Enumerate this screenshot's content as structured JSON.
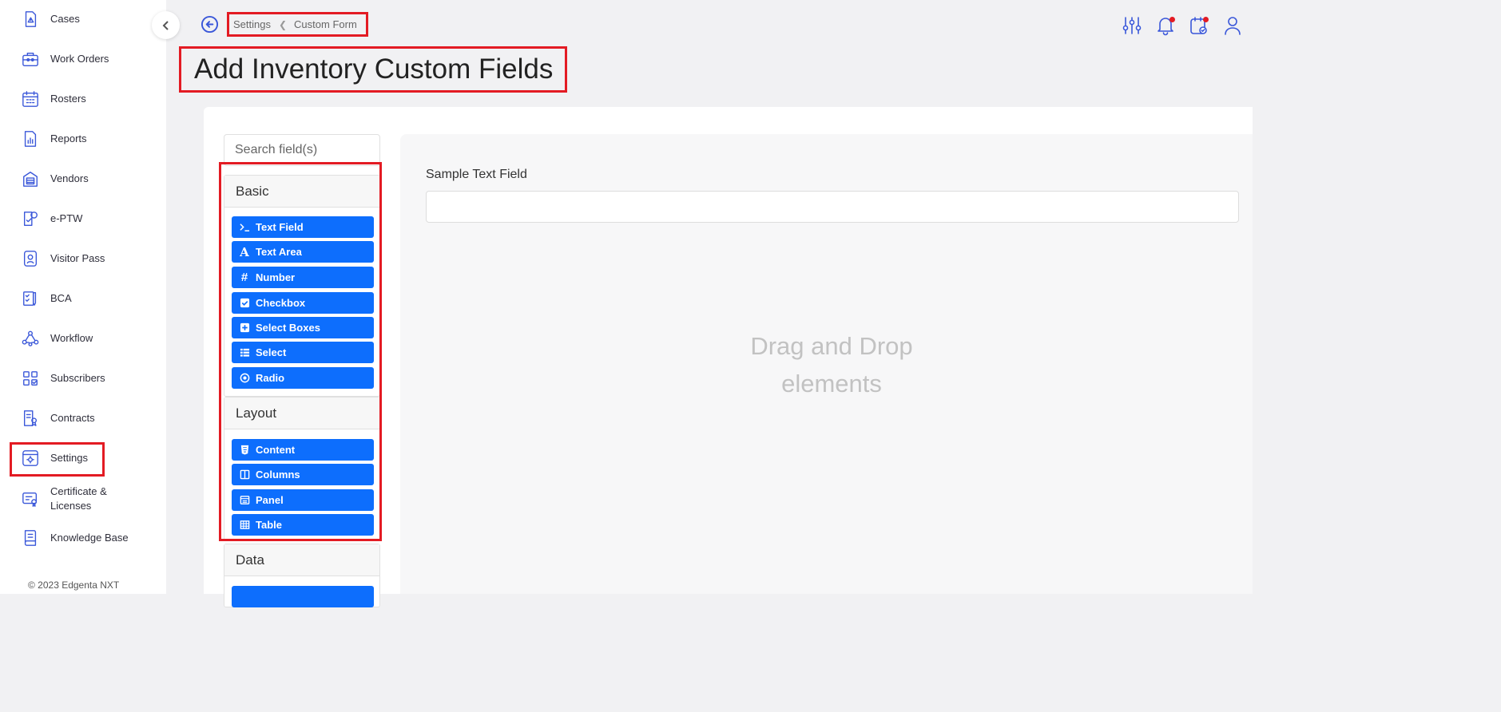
{
  "sidebar": {
    "items": [
      {
        "label": "Cases",
        "icon": "cases-icon"
      },
      {
        "label": "Work Orders",
        "icon": "briefcase-icon"
      },
      {
        "label": "Rosters",
        "icon": "calendar-icon"
      },
      {
        "label": "Reports",
        "icon": "report-icon"
      },
      {
        "label": "Vendors",
        "icon": "vendor-icon"
      },
      {
        "label": "e-PTW",
        "icon": "permit-icon"
      },
      {
        "label": "Visitor Pass",
        "icon": "badge-icon"
      },
      {
        "label": "BCA",
        "icon": "checklist-icon"
      },
      {
        "label": "Workflow",
        "icon": "workflow-icon"
      },
      {
        "label": "Subscribers",
        "icon": "grid-icon"
      },
      {
        "label": "Contracts",
        "icon": "contract-icon"
      },
      {
        "label": "Settings",
        "icon": "settings-icon"
      },
      {
        "label": "Certificate & Licenses",
        "icon": "certificate-icon"
      },
      {
        "label": "Knowledge Base",
        "icon": "book-icon"
      }
    ],
    "footer": "© 2023 Edgenta NXT"
  },
  "breadcrumb": {
    "parent": "Settings",
    "current": "Custom Form"
  },
  "page_title": "Add Inventory Custom Fields",
  "header_icons": [
    "filter-sliders-icon",
    "bell-icon",
    "task-icon",
    "user-icon"
  ],
  "builder": {
    "search_placeholder": "Search field(s)",
    "groups": {
      "basic": {
        "title": "Basic",
        "items": [
          {
            "label": "Text Field",
            "icon": "terminal-icon"
          },
          {
            "label": "Text Area",
            "icon": "font-icon"
          },
          {
            "label": "Number",
            "icon": "hash-icon"
          },
          {
            "label": "Checkbox",
            "icon": "check-square-icon"
          },
          {
            "label": "Select Boxes",
            "icon": "plus-square-icon"
          },
          {
            "label": "Select",
            "icon": "list-icon"
          },
          {
            "label": "Radio",
            "icon": "radio-icon"
          }
        ]
      },
      "layout": {
        "title": "Layout",
        "items": [
          {
            "label": "Content",
            "icon": "html5-icon"
          },
          {
            "label": "Columns",
            "icon": "columns-icon"
          },
          {
            "label": "Panel",
            "icon": "panel-icon"
          },
          {
            "label": "Table",
            "icon": "table-icon"
          }
        ]
      },
      "data": {
        "title": "Data"
      }
    },
    "canvas": {
      "sample_label": "Sample Text Field",
      "drop_line1": "Drag and Drop",
      "drop_line2": "elements"
    }
  },
  "colors": {
    "accent": "#3a57d9",
    "button": "#0d6efd",
    "highlight": "#e31b23"
  }
}
